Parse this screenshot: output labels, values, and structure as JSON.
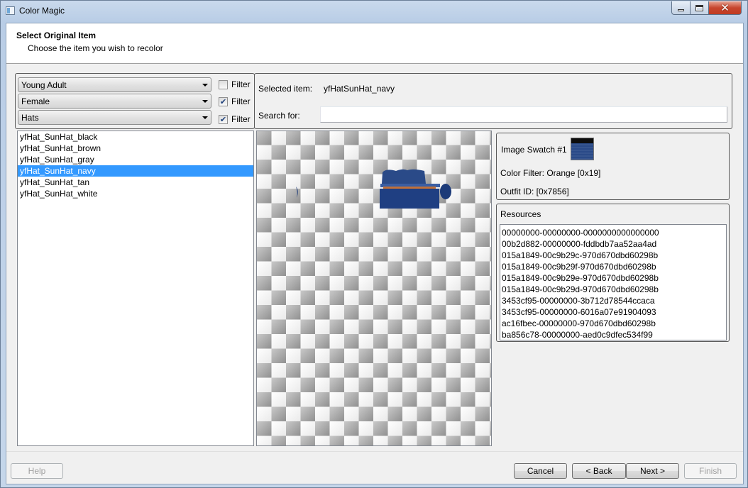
{
  "window": {
    "title": "Color Magic"
  },
  "header": {
    "title": "Select Original Item",
    "subtitle": "Choose the item you wish to recolor"
  },
  "filters": [
    {
      "value": "Young Adult",
      "filter_label": "Filter",
      "checked": false
    },
    {
      "value": "Female",
      "filter_label": "Filter",
      "checked": true
    },
    {
      "value": "Hats",
      "filter_label": "Filter",
      "checked": true
    }
  ],
  "items": [
    "yfHat_SunHat_black",
    "yfHat_SunHat_brown",
    "yfHat_SunHat_gray",
    "yfHat_SunHat_navy",
    "yfHat_SunHat_tan",
    "yfHat_SunHat_white"
  ],
  "selected_index": 3,
  "selection": {
    "selected_label": "Selected item:",
    "selected_value": "yfHatSunHat_navy",
    "search_label": "Search for:",
    "search_value": ""
  },
  "details": {
    "swatch_label": "Image Swatch #1",
    "color_filter": "Color Filter: Orange [0x19]",
    "outfit_id": "Outfit ID: [0x7856]"
  },
  "resources": {
    "title": "Resources",
    "items": [
      "00000000-00000000-0000000000000000",
      "00b2d882-00000000-fddbdb7aa52aa4ad",
      "015a1849-00c9b29c-970d670dbd60298b",
      "015a1849-00c9b29f-970d670dbd60298b",
      "015a1849-00c9b29e-970d670dbd60298b",
      "015a1849-00c9b29d-970d670dbd60298b",
      "3453cf95-00000000-3b712d78544ccaca",
      "3453cf95-00000000-6016a07e91904093",
      "ac16fbec-00000000-970d670dbd60298b",
      "ba856c78-00000000-aed0c9dfec534f99"
    ]
  },
  "buttons": {
    "help": "Help",
    "cancel": "Cancel",
    "back": "< Back",
    "next": "Next >",
    "finish": "Finish"
  },
  "colors": {
    "selection": "#3399ff",
    "hat_navy": "#2a4a88",
    "hat_band": "#c0703a"
  }
}
